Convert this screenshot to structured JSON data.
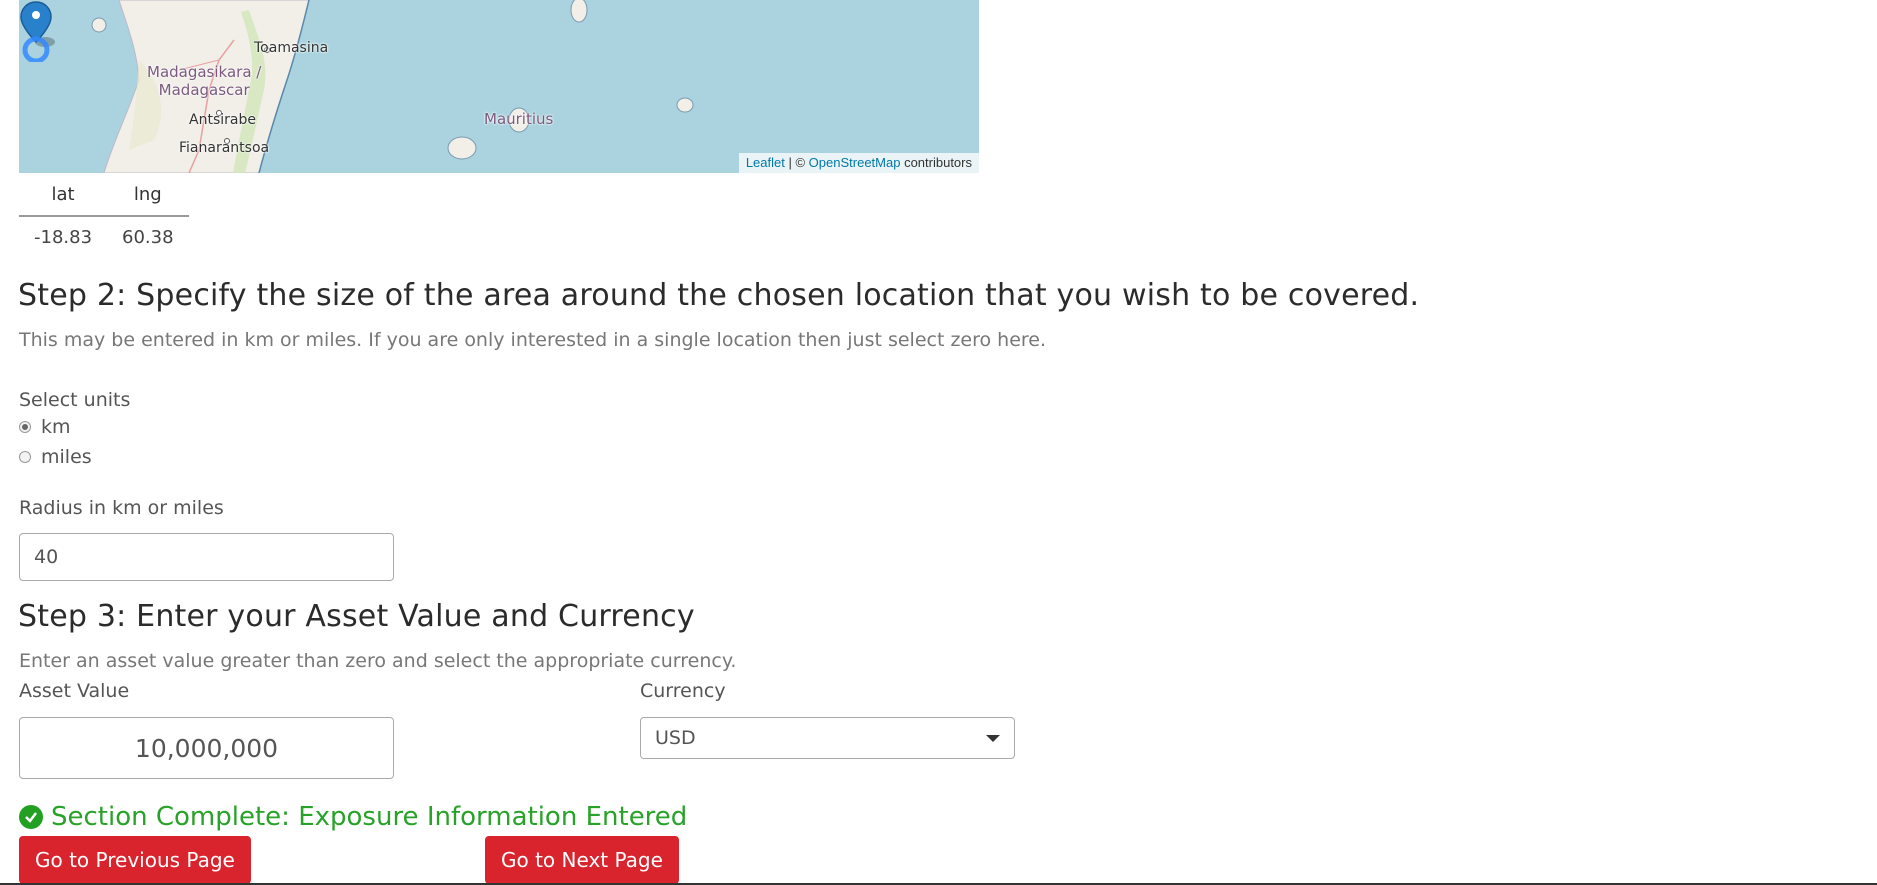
{
  "map": {
    "labels": {
      "toamasina": "Toamasina",
      "madagascar": "Madagasikara /\nMadagascar",
      "antsirabe": "Antsirabe",
      "fianarantsoa": "Fianarantsoa",
      "mauritius": "Mauritius"
    },
    "attribution": {
      "leaflet": "Leaflet",
      "sep": " | © ",
      "osm": "OpenStreetMap",
      "contributors": " contributors"
    },
    "colors": {
      "water": "#aad3df",
      "land": "#f2efe9",
      "marker": "#2a81cb"
    }
  },
  "coords": {
    "headers": {
      "lat": "lat",
      "lng": "lng"
    },
    "values": {
      "lat": "-18.83",
      "lng": "60.38"
    }
  },
  "step2": {
    "title": "Step 2: Specify the size of the area around the chosen location that you wish to be covered.",
    "help": "This may be entered in km or miles. If you are only interested in a single location then just select zero here.",
    "units_label": "Select units",
    "options": [
      "km",
      "miles"
    ],
    "selected": "km",
    "radius_label": "Radius in km or miles",
    "radius_value": "40"
  },
  "step3": {
    "title": "Step 3: Enter your Asset Value and Currency",
    "help": "Enter an asset value greater than zero and select the appropriate currency.",
    "asset_label": "Asset Value",
    "asset_value": "10,000,000",
    "currency_label": "Currency",
    "currency_value": "USD"
  },
  "status": {
    "text": "Section Complete: Exposure Information Entered",
    "color": "#28a228",
    "icon": "check-circle-icon"
  },
  "nav": {
    "prev": "Go to Previous Page",
    "next": "Go to Next Page",
    "button_color": "#d9232d"
  }
}
